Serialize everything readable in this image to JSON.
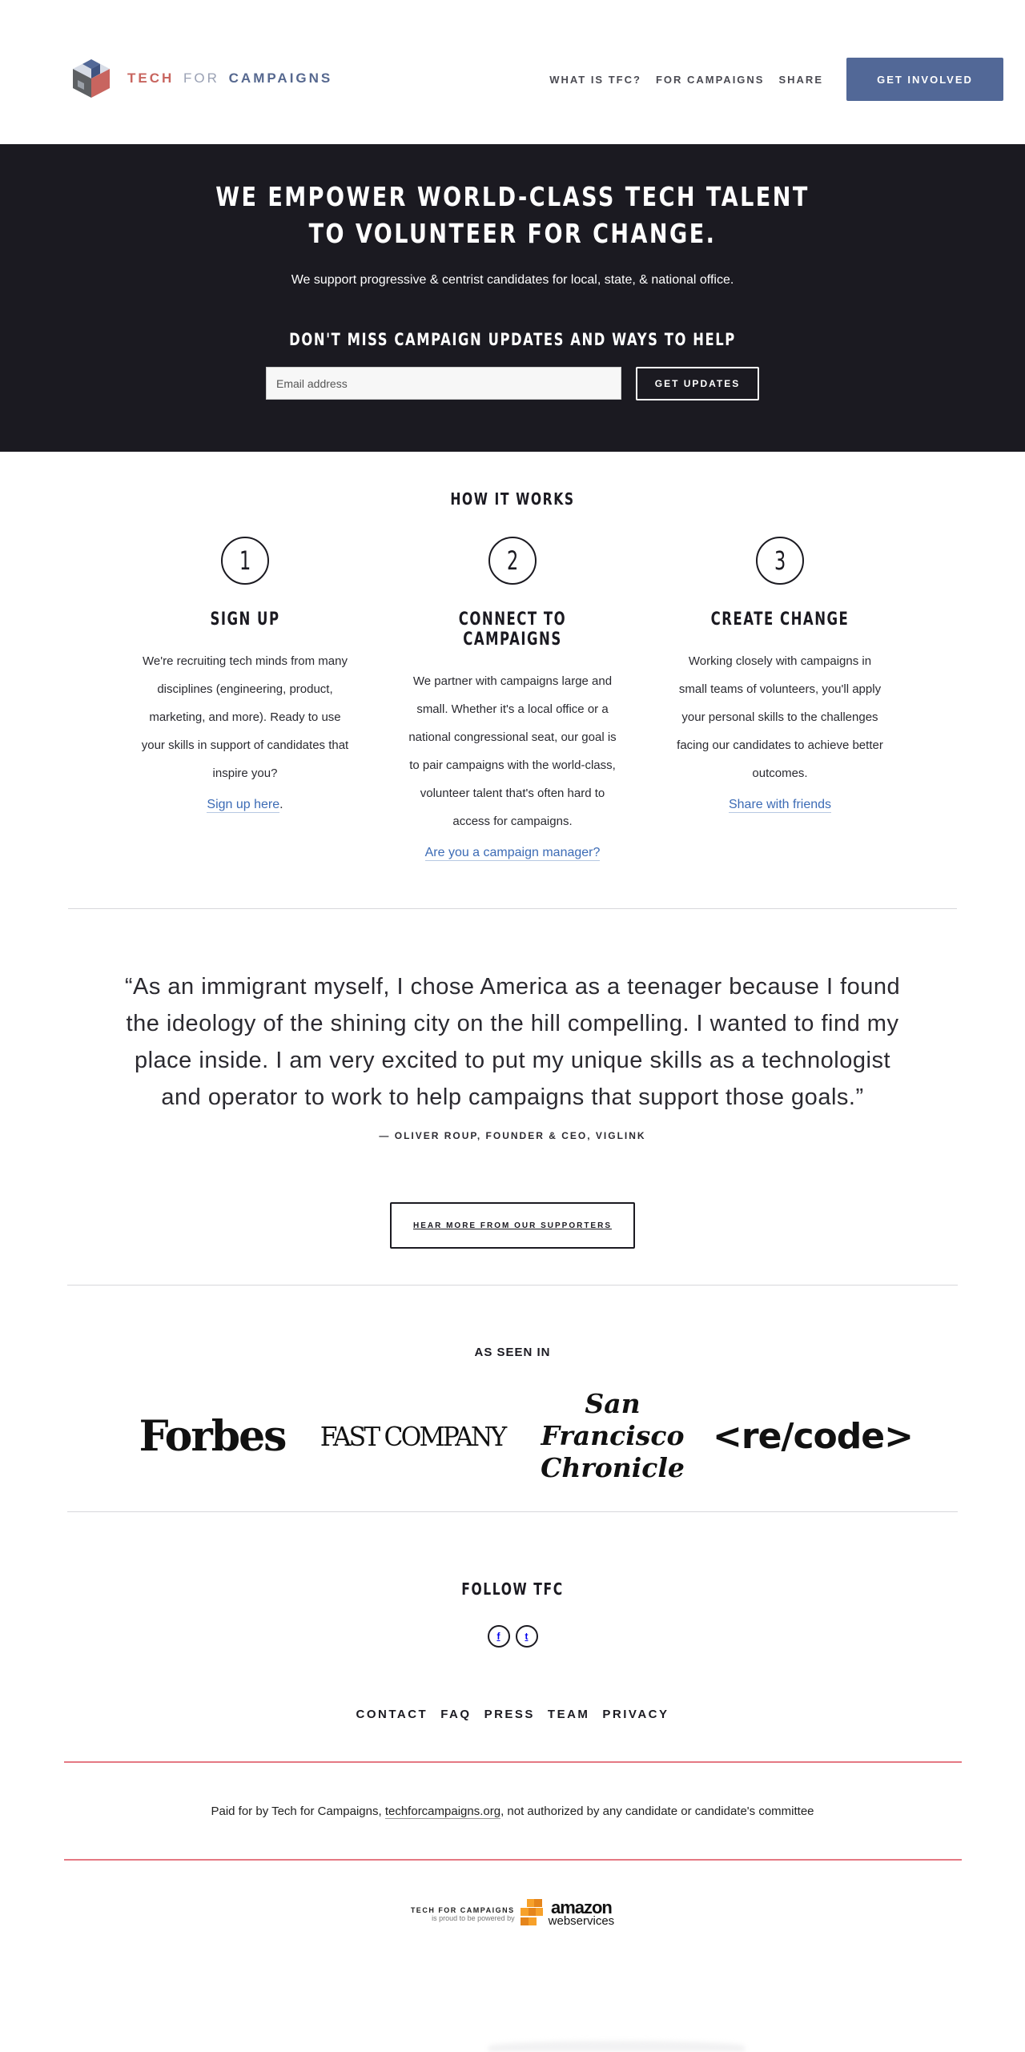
{
  "header": {
    "logo": {
      "tech": "TECH",
      "for": "FOR",
      "campaigns": "CAMPAIGNS"
    },
    "nav": [
      "WHAT IS TFC?",
      "FOR CAMPAIGNS",
      "SHARE"
    ],
    "cta": "GET INVOLVED"
  },
  "hero": {
    "title_line1": "WE EMPOWER WORLD-CLASS TECH TALENT",
    "title_line2": "TO VOLUNTEER FOR CHANGE.",
    "subtitle": "We support progressive & centrist candidates for local, state, & national office.",
    "updates_title": "DON'T MISS CAMPAIGN UPDATES AND WAYS TO HELP",
    "email_placeholder": "Email address",
    "submit": "GET UPDATES"
  },
  "how": {
    "title": "HOW IT WORKS",
    "steps": [
      {
        "num": "1",
        "title": "SIGN UP",
        "text": "We're recruiting tech minds from many disciplines (engineering, product, marketing, and more). Ready to use your skills in support of candidates that inspire you?",
        "link": "Sign up here",
        "suffix": "."
      },
      {
        "num": "2",
        "title": "CONNECT TO CAMPAIGNS",
        "text": "We partner with campaigns large and small. Whether it's a local office or a national congressional seat, our goal is to pair campaigns with the world-class, volunteer talent that's often hard to access for campaigns.",
        "link": "Are you a campaign manager?",
        "suffix": ""
      },
      {
        "num": "3",
        "title": "CREATE CHANGE",
        "text": "Working closely with campaigns in small teams of volunteers, you'll apply your personal skills to the challenges facing our candidates to achieve better outcomes.",
        "link": "Share with friends",
        "suffix": ""
      }
    ]
  },
  "quote": {
    "text": "“As an immigrant myself, I chose America as a teenager because I found the ideology of the shining city on the hill compelling. I wanted to find my place inside. I am very excited to put my unique skills as a technologist and operator to work to help campaigns that support those goals.”",
    "attribution": "— OLIVER ROUP, FOUNDER & CEO, VIGLINK",
    "button": "HEAR MORE FROM OUR SUPPORTERS"
  },
  "seen": {
    "title": "AS SEEN IN",
    "logos": [
      "Forbes",
      "FAST COMPANY",
      "San Francisco Chronicle",
      "<re/code>"
    ]
  },
  "follow": {
    "title": "FOLLOW TFC",
    "social": [
      {
        "icon": "facebook-icon",
        "glyph": "f"
      },
      {
        "icon": "twitter-icon",
        "glyph": "t"
      }
    ],
    "links": [
      "CONTACT",
      "FAQ",
      "PRESS",
      "TEAM",
      "PRIVACY"
    ]
  },
  "disclaimer": {
    "before": "Paid for by Tech for Campaigns, ",
    "link": "techforcampaigns.org",
    "after": ", not authorized by any candidate or candidate's committee"
  },
  "aws": {
    "line1": "TECH FOR CAMPAIGNS",
    "line2": "is proud to be powered by",
    "brand": "amazon",
    "brand2": "webservices"
  },
  "colors": {
    "brand_blue": "#526897",
    "brand_red": "#c8655f",
    "hero_bg": "#1b1a21",
    "link": "#3c6bb5",
    "divider_pink": "#e57883"
  }
}
